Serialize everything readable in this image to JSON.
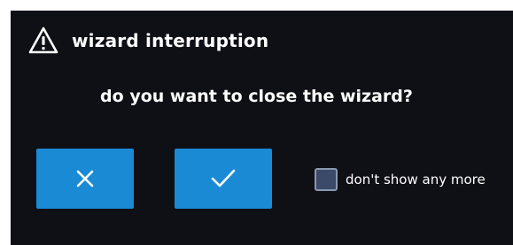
{
  "dialog": {
    "title": "wizard interruption",
    "title_icon": "warning-triangle-icon",
    "message": "do you want to close the wizard?",
    "cancel_icon": "close-icon",
    "confirm_icon": "checkmark-icon",
    "checkbox_label": "don't show any more",
    "checkbox_checked": false
  },
  "colors": {
    "dialog_background": "#0f0f16",
    "button_accent": "#1a8ad4",
    "checkbox_fill": "#3a4a68",
    "text": "#ffffff"
  }
}
